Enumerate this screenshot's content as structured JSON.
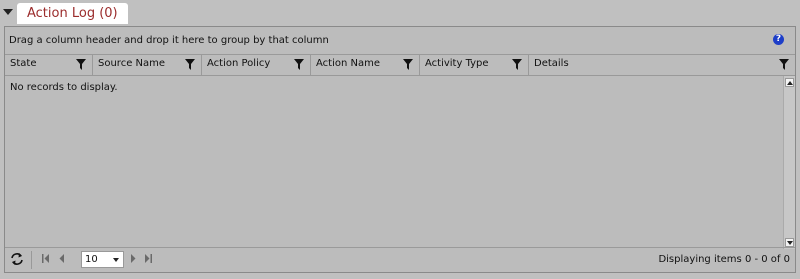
{
  "section": {
    "title": "Action Log (0)"
  },
  "grid": {
    "group_panel_text": "Drag a column header and drop it here to group by that column",
    "help_icon_glyph": "?",
    "columns": [
      {
        "label": "State"
      },
      {
        "label": "Source Name"
      },
      {
        "label": "Action Policy"
      },
      {
        "label": "Action Name"
      },
      {
        "label": "Activity Type"
      },
      {
        "label": "Details"
      }
    ],
    "empty_message": "No records to display."
  },
  "pager": {
    "page_size": "10",
    "status": "Displaying items 0 - 0 of 0"
  },
  "colors": {
    "background": "#c0c0c0",
    "title_text": "#9b2c2c",
    "help_icon": "#1d3ec8"
  }
}
